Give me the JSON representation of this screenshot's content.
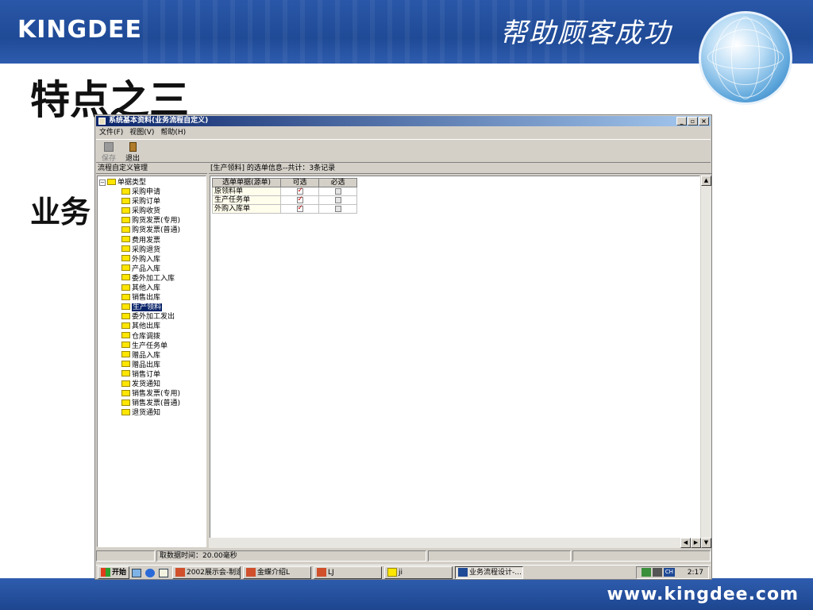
{
  "slide": {
    "brand": "KINGDEE",
    "slogan": "帮助顾客成功",
    "title": "特点之三",
    "subtitle": "业务",
    "footer_url": "www.kingdee.com"
  },
  "window": {
    "title": "系统基本资料(业务流程自定义)",
    "menu": [
      "文件(F)",
      "视图(V)",
      "帮助(H)"
    ],
    "toolbar": {
      "save_label": "保存",
      "exit_label": "退出"
    },
    "left_panel": {
      "header": "流程自定义管理",
      "root": "单据类型",
      "items": [
        "采购申请",
        "采购订单",
        "采购收货",
        "购货发票(专用)",
        "购货发票(普通)",
        "费用发票",
        "采购退货",
        "外购入库",
        "产品入库",
        "委外加工入库",
        "其他入库",
        "销售出库",
        "生产领料",
        "委外加工发出",
        "其他出库",
        "仓库调拨",
        "生产任务单",
        "赠品入库",
        "赠品出库",
        "销售订单",
        "发货通知",
        "销售发票(专用)",
        "销售发票(普通)",
        "退货通知"
      ],
      "selected": "生产领料"
    },
    "right_panel": {
      "header": "[生产领料]   的选单信息--共计：3条记录",
      "columns": [
        "选单单据(源单)",
        "可选",
        "必选"
      ],
      "rows": [
        {
          "name": "原领料单",
          "optional": true,
          "required": false
        },
        {
          "name": "生产任务单",
          "optional": true,
          "required": false
        },
        {
          "name": "外购入库单",
          "optional": true,
          "required": false
        }
      ]
    },
    "status": {
      "fetch_time": "取数据时间：20.00毫秒"
    },
    "taskbar": {
      "start": "开始",
      "tasks": [
        "2002展示会-制造",
        "金蝶介绍L",
        "LJ",
        "业务流程设计-..."
      ],
      "tasks_extra": "ji",
      "active_task": "业务流程设计-...",
      "ime": "CH",
      "clock": "2:17"
    }
  }
}
